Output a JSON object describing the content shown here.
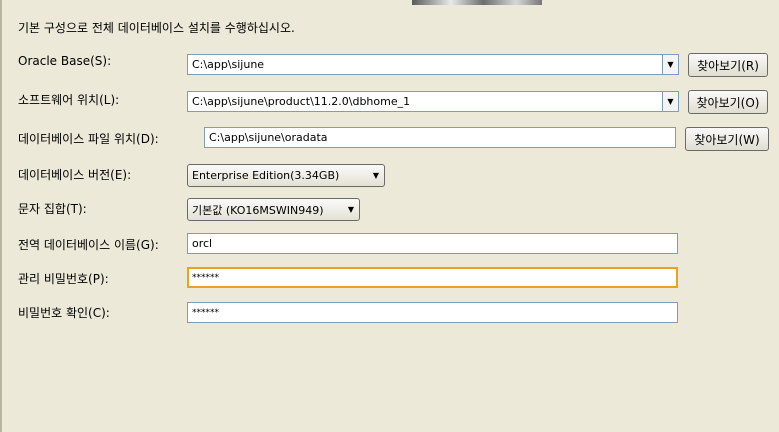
{
  "intro": "기본 구성으로 전체 데이터베이스 설치를 수행하십시오.",
  "oracle_base": {
    "label": "Oracle Base(S):",
    "value": "C:\\app\\sijune",
    "browse": "찾아보기(R)"
  },
  "software_location": {
    "label": "소프트웨어 위치(L):",
    "value": "C:\\app\\sijune\\product\\11.2.0\\dbhome_1",
    "browse": "찾아보기(O)"
  },
  "db_file_location": {
    "label": "데이터베이스 파일 위치(D):",
    "value": "C:\\app\\sijune\\oradata",
    "browse": "찾아보기(W)"
  },
  "db_edition": {
    "label": "데이터베이스 버전(E):",
    "value": "Enterprise Edition(3.34GB)"
  },
  "charset": {
    "label": "문자 집합(T):",
    "value": "기본값 (KO16MSWIN949)"
  },
  "global_db_name": {
    "label": "전역 데이터베이스 이름(G):",
    "value": "orcl"
  },
  "admin_password": {
    "label": "관리 비밀번호(P):",
    "value": "******"
  },
  "confirm_password": {
    "label": "비밀번호 확인(C):",
    "value": "******"
  }
}
